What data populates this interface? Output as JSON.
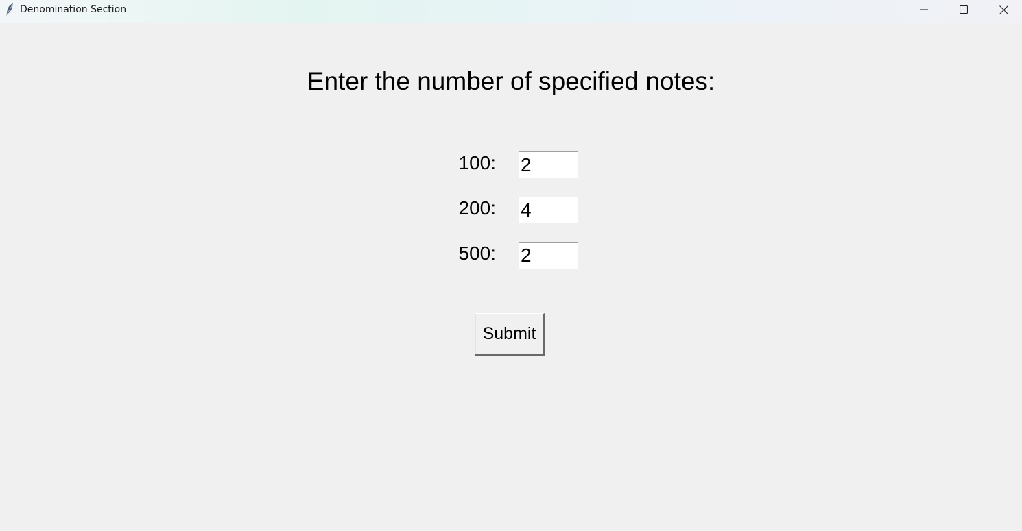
{
  "window": {
    "title": "Denomination Section",
    "icon": "feather-icon",
    "controls": {
      "minimize_icon": "minimize-icon",
      "maximize_icon": "maximize-icon",
      "close_icon": "close-icon"
    }
  },
  "form": {
    "heading": "Enter the number of specified notes:",
    "fields": [
      {
        "label": "100:",
        "value": "2"
      },
      {
        "label": "200:",
        "value": "4"
      },
      {
        "label": "500:",
        "value": "2"
      }
    ],
    "submit_label": "Submit"
  }
}
